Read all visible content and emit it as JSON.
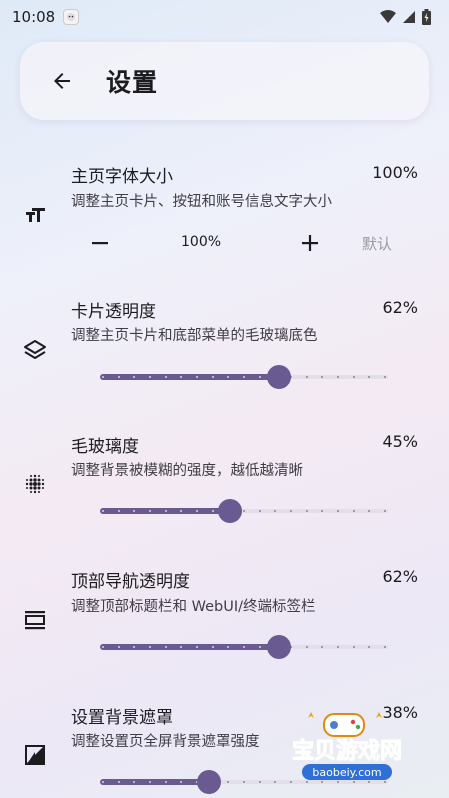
{
  "status_bar": {
    "time": "10:08"
  },
  "header": {
    "title": "设置"
  },
  "settings": [
    {
      "title": "主页字体大小",
      "value": "100%",
      "desc": "调整主页卡片、按钮和账号信息文字大小",
      "icon": "text-size-icon"
    },
    {
      "title": "卡片透明度",
      "value": "62%",
      "desc": "调整主页卡片和底部菜单的毛玻璃底色",
      "icon": "layers-icon",
      "level": 0.62
    },
    {
      "title": "毛玻璃度",
      "value": "45%",
      "desc": "调整背景被模糊的强度，越低越清晰",
      "icon": "blur-icon",
      "level": 0.45
    },
    {
      "title": "顶部导航透明度",
      "value": "62%",
      "desc": "调整顶部标题栏和 WebUI/终端标签栏",
      "icon": "top-bar-icon",
      "level": 0.62
    },
    {
      "title": "设置背景遮罩",
      "value": "38%",
      "desc": "调整设置页全屏背景遮罩强度",
      "icon": "contrast-icon",
      "level": 0.38
    }
  ],
  "font_stepper": {
    "value": "100%",
    "reset_label": "默认"
  },
  "watermark": {
    "text": "宝贝游戏网",
    "url": "baobeiy.com"
  },
  "colors": {
    "accent": "#6a5a92",
    "track": "#e2dfe9",
    "watermark": "#f0a020"
  }
}
